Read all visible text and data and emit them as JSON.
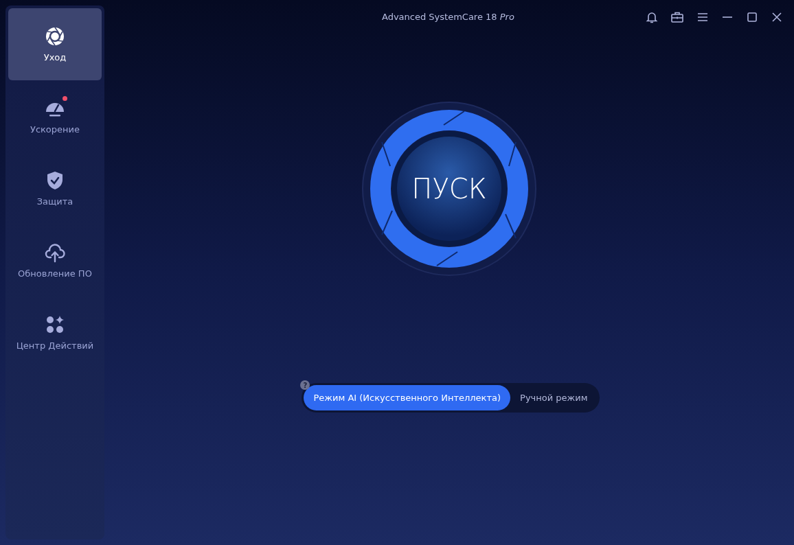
{
  "window": {
    "title": "Advanced SystemCare 18 *Pro*"
  },
  "sidebar": {
    "items": [
      {
        "label": "Уход",
        "selected": true,
        "notification": false,
        "kind": "care"
      },
      {
        "label": "Ускорение",
        "selected": false,
        "notification": true,
        "kind": "speed"
      },
      {
        "label": "Защита",
        "selected": false,
        "notification": false,
        "kind": "protect"
      },
      {
        "label": "Обновление ПО",
        "selected": false,
        "notification": false,
        "kind": "update"
      },
      {
        "label": "Центр Действий",
        "selected": false,
        "notification": false,
        "kind": "action"
      }
    ]
  },
  "start_button": {
    "label": "ПУСК"
  },
  "mode_switch": {
    "help": "?",
    "options": [
      {
        "label": "Режим AI (Искусственного Интеллекта)",
        "selected": true
      },
      {
        "label": "Ручной режим",
        "selected": false
      }
    ]
  }
}
